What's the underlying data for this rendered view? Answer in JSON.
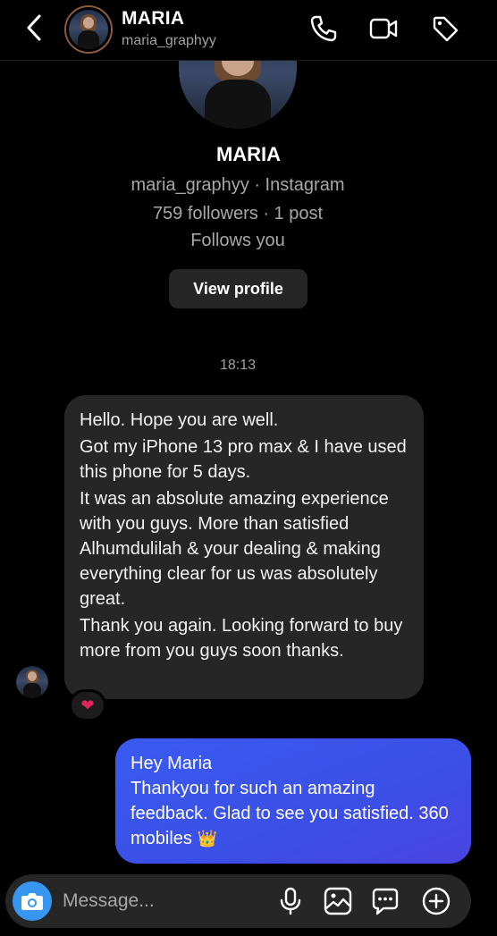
{
  "header": {
    "name": "MARIA",
    "handle": "maria_graphyy",
    "icons": [
      "back-chevron-icon",
      "phone-icon",
      "video-camera-icon",
      "tag-icon"
    ]
  },
  "profile": {
    "name": "MARIA",
    "handle_line": "maria_graphyy · Instagram",
    "stats_line": "759 followers · 1 post",
    "follow_status": "Follows you",
    "view_profile_label": "View profile"
  },
  "conversation": {
    "timestamp": "18:13",
    "incoming": {
      "lines": [
        "Hello. Hope you are well.",
        "Got my iPhone 13 pro max & I have used this phone for 5 days.",
        "It was an absolute amazing experience with you guys. More than satisfied Alhumdulilah & your dealing & making everything clear for us was absolutely great.",
        "Thank you again. Looking forward to buy more from you guys soon thanks."
      ],
      "reaction": "❤"
    },
    "outgoing": {
      "lines": [
        "Hey Maria",
        "Thankyou for such an amazing feedback. Glad to see you satisfied. 360 mobiles"
      ],
      "emoji": "👑"
    }
  },
  "composer": {
    "placeholder": "Message...",
    "icons": [
      "camera-icon",
      "microphone-icon",
      "image-icon",
      "sticker-icon",
      "add-icon"
    ]
  },
  "colors": {
    "background": "#000000",
    "incoming_bubble": "#262626",
    "outgoing_bubble": "#3b4fe6",
    "camera_button": "#3797f0"
  }
}
